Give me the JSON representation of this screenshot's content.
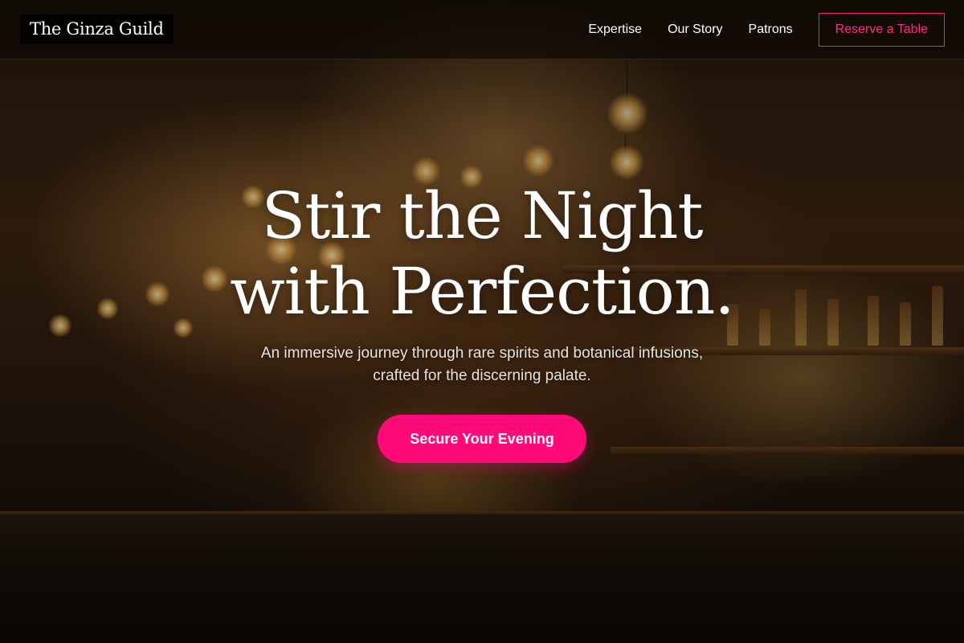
{
  "brand": {
    "name": "The Ginza Guild"
  },
  "nav": {
    "links": [
      {
        "label": "Expertise"
      },
      {
        "label": "Our Story"
      },
      {
        "label": "Patrons"
      }
    ],
    "cta_label": "Reserve a Table"
  },
  "hero": {
    "title_line1": "Stir the Night",
    "title_line2": "with Perfection.",
    "subtitle_line1": "An immersive journey through rare spirits and botanical infusions,",
    "subtitle_line2": "crafted for the discerning palate.",
    "cta_label": "Secure Your Evening",
    "background_description_icon": "bar-interior-image"
  },
  "colors": {
    "accent": "#ff0a78",
    "nav_background": "#0f0a06",
    "text": "#ffffff"
  }
}
